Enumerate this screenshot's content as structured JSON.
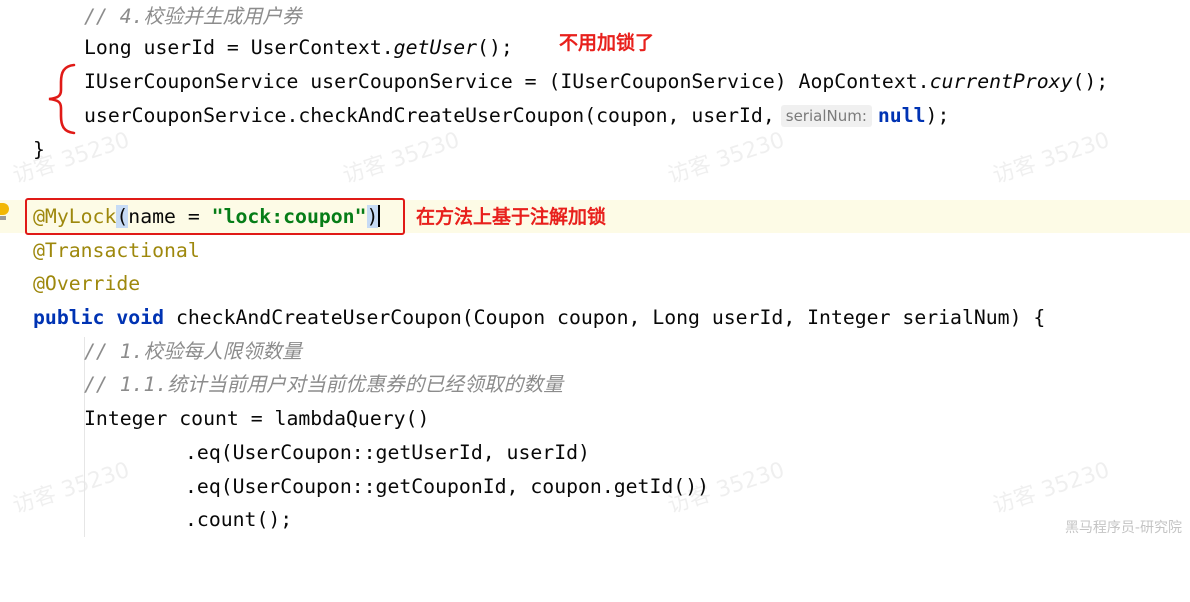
{
  "annotations": {
    "no_lock_note": "不用加锁了",
    "method_lock_note": "在方法上基于注解加锁"
  },
  "watermark": {
    "text": "访客 35230"
  },
  "brand": "黑马程序员-研究院",
  "code": {
    "l1_comment": "// 4.校验并生成用户券",
    "l2_a": "Long userId = UserContext.",
    "l2_method": "getUser",
    "l2_b": "();",
    "l3_a": "IUserCouponService userCouponService = (IUserCouponService) AopContext.",
    "l3_method": "currentProxy",
    "l3_b": "();",
    "l4_a": "userCouponService.checkAndCreateUserCoupon(coupon, userId,",
    "l4_hint": "serialNum:",
    "l4_null": "null",
    "l4_b": ");",
    "l5_brace": "}",
    "l7_annotation": "@MyLock",
    "l7_paren_open": "(",
    "l7_name": "name = ",
    "l7_string": "\"lock:coupon\"",
    "l7_paren_close": ")",
    "l8_annotation": "@Transactional",
    "l9_annotation": "@Override",
    "l10_public": "public",
    "l10_void": "void",
    "l10_rest": " checkAndCreateUserCoupon(Coupon coupon, Long userId, Integer serialNum) {",
    "l11_comment": "// 1.校验每人限领数量",
    "l12_comment": "// 1.1.统计当前用户对当前优惠券的已经领取的数量",
    "l13": "Integer count = lambdaQuery()",
    "l14": ".eq(UserCoupon::getUserId, userId)",
    "l15": ".eq(UserCoupon::getCouponId, coupon.getId())",
    "l16": ".count();"
  },
  "colors": {
    "annotation_red": "#e01a17",
    "keyword": "#0033b3",
    "string": "#067d17",
    "comment": "#8c8c8c",
    "annotation": "#9e880d"
  }
}
